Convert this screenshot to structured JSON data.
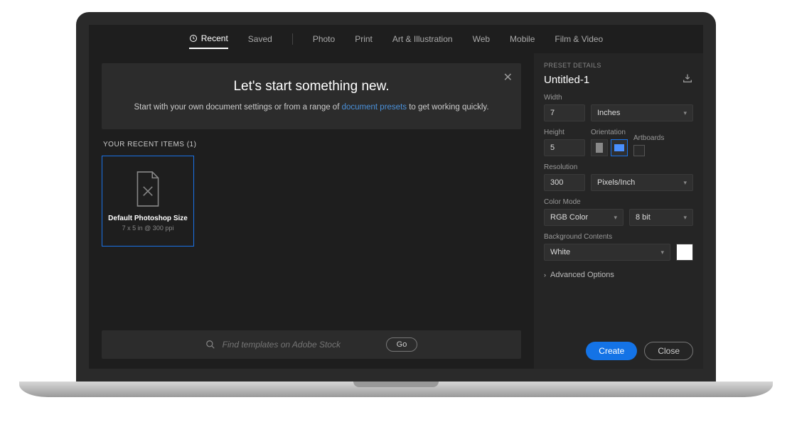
{
  "tabs": {
    "recent": "Recent",
    "saved": "Saved",
    "photo": "Photo",
    "print": "Print",
    "art": "Art & Illustration",
    "web": "Web",
    "mobile": "Mobile",
    "film": "Film & Video"
  },
  "intro": {
    "title": "Let's start something new.",
    "line_pre": "Start with your own document settings or from a range of ",
    "link": "document presets",
    "line_post": " to get working quickly."
  },
  "recent": {
    "label": "YOUR RECENT ITEMS  (1)",
    "card": {
      "name": "Default Photoshop Size",
      "sub": "7 x 5 in @ 300 ppi"
    }
  },
  "search": {
    "placeholder": "Find templates on Adobe Stock",
    "go": "Go"
  },
  "panel": {
    "header": "PRESET DETAILS",
    "doc_name": "Untitled-1",
    "width_label": "Width",
    "width_value": "7",
    "units": "Inches",
    "height_label": "Height",
    "height_value": "5",
    "orientation_label": "Orientation",
    "artboards_label": "Artboards",
    "resolution_label": "Resolution",
    "resolution_value": "300",
    "resolution_units": "Pixels/Inch",
    "colormode_label": "Color Mode",
    "colormode_value": "RGB Color",
    "colordepth": "8 bit",
    "bg_label": "Background Contents",
    "bg_value": "White",
    "advanced": "Advanced Options",
    "create": "Create",
    "close": "Close"
  }
}
